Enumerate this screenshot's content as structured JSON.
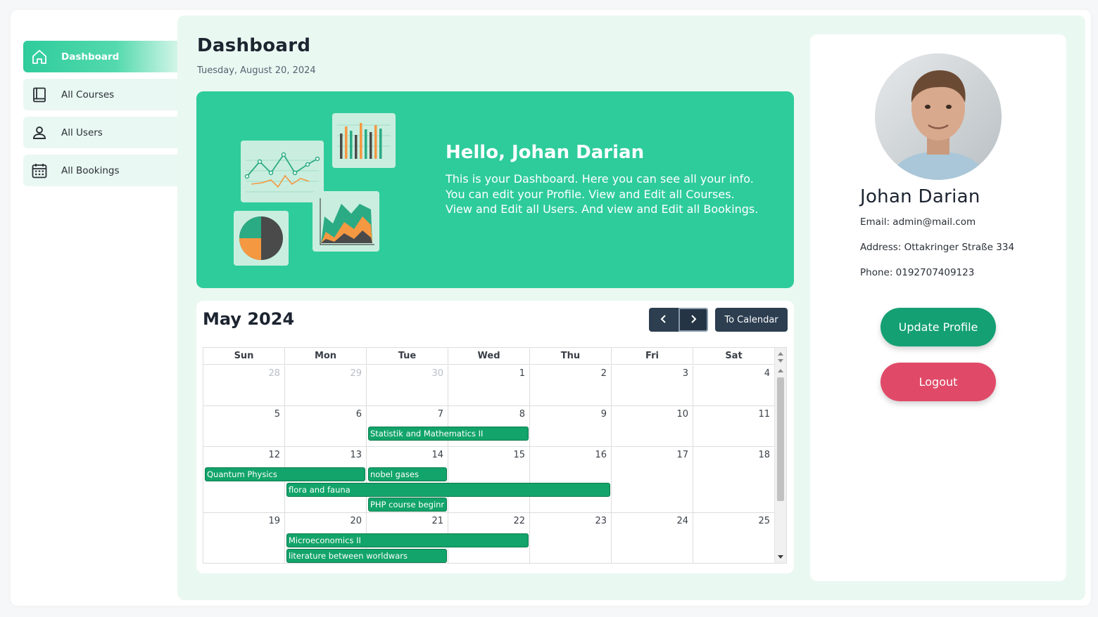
{
  "sidebar": {
    "items": [
      {
        "label": "Dashboard",
        "icon": "home-icon",
        "active": true
      },
      {
        "label": "All Courses",
        "icon": "book-icon",
        "active": false
      },
      {
        "label": "All Users",
        "icon": "user-icon",
        "active": false
      },
      {
        "label": "All Bookings",
        "icon": "calendar-icon",
        "active": false
      }
    ]
  },
  "header": {
    "title": "Dashboard",
    "date": "Tuesday, August 20, 2024"
  },
  "hero": {
    "title": "Hello, Johan Darian",
    "text": "This is your Dashboard. Here you can see all your info. You can edit your Profile. View and Edit all Courses. View and Edit all Users. And view and Edit all Bookings."
  },
  "calendar": {
    "title": "May 2024",
    "today_button": "To Calendar",
    "weekdays": [
      "Sun",
      "Mon",
      "Tue",
      "Wed",
      "Thu",
      "Fri",
      "Sat"
    ],
    "weeks": [
      {
        "days": [
          "28",
          "29",
          "30",
          "1",
          "2",
          "3",
          "4"
        ],
        "other_month": [
          true,
          true,
          true,
          false,
          false,
          false,
          false
        ]
      },
      {
        "days": [
          "5",
          "6",
          "7",
          "8",
          "9",
          "10",
          "11"
        ],
        "other_month": [
          false,
          false,
          false,
          false,
          false,
          false,
          false
        ]
      },
      {
        "days": [
          "12",
          "13",
          "14",
          "15",
          "16",
          "17",
          "18"
        ],
        "other_month": [
          false,
          false,
          false,
          false,
          false,
          false,
          false
        ]
      },
      {
        "days": [
          "19",
          "20",
          "21",
          "22",
          "23",
          "24",
          "25"
        ],
        "other_month": [
          false,
          false,
          false,
          false,
          false,
          false,
          false
        ]
      }
    ],
    "events": [
      {
        "title": "Statistik and Mathematics II",
        "start": "2024-05-07",
        "end": "2024-05-08"
      },
      {
        "title": "Quantum Physics",
        "start": "2024-05-12",
        "end": "2024-05-13"
      },
      {
        "title": "nobel gases",
        "start": "2024-05-14",
        "end": "2024-05-14"
      },
      {
        "title": "flora and fauna",
        "start": "2024-05-13",
        "end": "2024-05-16"
      },
      {
        "title": "PHP course beginr",
        "start": "2024-05-14",
        "end": "2024-05-14"
      },
      {
        "title": "Microeconomics II",
        "start": "2024-05-20",
        "end": "2024-05-22"
      },
      {
        "title": "literature between worldwars",
        "start": "2024-05-20",
        "end": "2024-05-21"
      }
    ],
    "event_color": "#12a46a"
  },
  "profile": {
    "name": "Johan Darian",
    "email": "Email: admin@mail.com",
    "address": "Address: Ottakringer Straße 334",
    "phone": "Phone: 0192707409123",
    "update_button": "Update Profile",
    "logout_button": "Logout"
  },
  "colors": {
    "accent": "#2ecc9b",
    "dark": "#2c3e50",
    "update": "#14a073",
    "logout": "#e04a68"
  }
}
